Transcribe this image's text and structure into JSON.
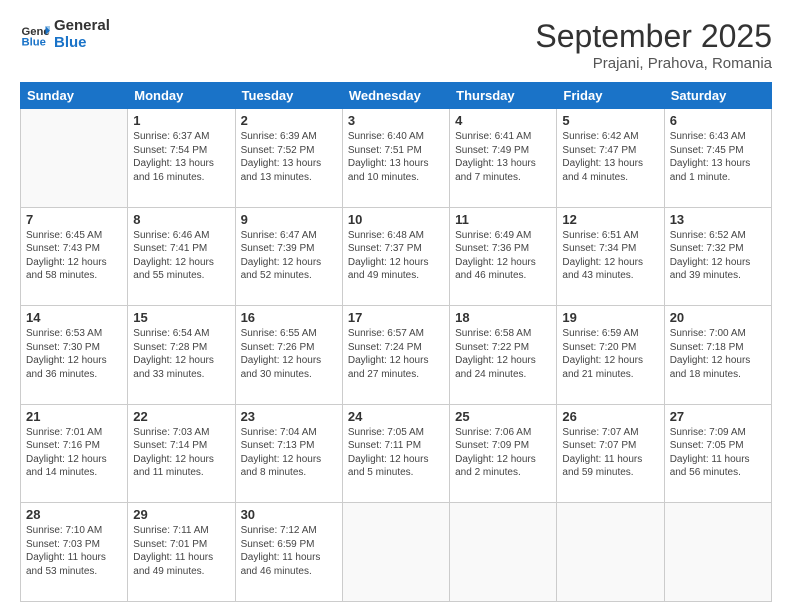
{
  "logo": {
    "line1": "General",
    "line2": "Blue"
  },
  "title": "September 2025",
  "location": "Prajani, Prahova, Romania",
  "days_header": [
    "Sunday",
    "Monday",
    "Tuesday",
    "Wednesday",
    "Thursday",
    "Friday",
    "Saturday"
  ],
  "weeks": [
    [
      {
        "day": "",
        "info": ""
      },
      {
        "day": "1",
        "info": "Sunrise: 6:37 AM\nSunset: 7:54 PM\nDaylight: 13 hours and 16 minutes."
      },
      {
        "day": "2",
        "info": "Sunrise: 6:39 AM\nSunset: 7:52 PM\nDaylight: 13 hours and 13 minutes."
      },
      {
        "day": "3",
        "info": "Sunrise: 6:40 AM\nSunset: 7:51 PM\nDaylight: 13 hours and 10 minutes."
      },
      {
        "day": "4",
        "info": "Sunrise: 6:41 AM\nSunset: 7:49 PM\nDaylight: 13 hours and 7 minutes."
      },
      {
        "day": "5",
        "info": "Sunrise: 6:42 AM\nSunset: 7:47 PM\nDaylight: 13 hours and 4 minutes."
      },
      {
        "day": "6",
        "info": "Sunrise: 6:43 AM\nSunset: 7:45 PM\nDaylight: 13 hours and 1 minute."
      }
    ],
    [
      {
        "day": "7",
        "info": "Sunrise: 6:45 AM\nSunset: 7:43 PM\nDaylight: 12 hours and 58 minutes."
      },
      {
        "day": "8",
        "info": "Sunrise: 6:46 AM\nSunset: 7:41 PM\nDaylight: 12 hours and 55 minutes."
      },
      {
        "day": "9",
        "info": "Sunrise: 6:47 AM\nSunset: 7:39 PM\nDaylight: 12 hours and 52 minutes."
      },
      {
        "day": "10",
        "info": "Sunrise: 6:48 AM\nSunset: 7:37 PM\nDaylight: 12 hours and 49 minutes."
      },
      {
        "day": "11",
        "info": "Sunrise: 6:49 AM\nSunset: 7:36 PM\nDaylight: 12 hours and 46 minutes."
      },
      {
        "day": "12",
        "info": "Sunrise: 6:51 AM\nSunset: 7:34 PM\nDaylight: 12 hours and 43 minutes."
      },
      {
        "day": "13",
        "info": "Sunrise: 6:52 AM\nSunset: 7:32 PM\nDaylight: 12 hours and 39 minutes."
      }
    ],
    [
      {
        "day": "14",
        "info": "Sunrise: 6:53 AM\nSunset: 7:30 PM\nDaylight: 12 hours and 36 minutes."
      },
      {
        "day": "15",
        "info": "Sunrise: 6:54 AM\nSunset: 7:28 PM\nDaylight: 12 hours and 33 minutes."
      },
      {
        "day": "16",
        "info": "Sunrise: 6:55 AM\nSunset: 7:26 PM\nDaylight: 12 hours and 30 minutes."
      },
      {
        "day": "17",
        "info": "Sunrise: 6:57 AM\nSunset: 7:24 PM\nDaylight: 12 hours and 27 minutes."
      },
      {
        "day": "18",
        "info": "Sunrise: 6:58 AM\nSunset: 7:22 PM\nDaylight: 12 hours and 24 minutes."
      },
      {
        "day": "19",
        "info": "Sunrise: 6:59 AM\nSunset: 7:20 PM\nDaylight: 12 hours and 21 minutes."
      },
      {
        "day": "20",
        "info": "Sunrise: 7:00 AM\nSunset: 7:18 PM\nDaylight: 12 hours and 18 minutes."
      }
    ],
    [
      {
        "day": "21",
        "info": "Sunrise: 7:01 AM\nSunset: 7:16 PM\nDaylight: 12 hours and 14 minutes."
      },
      {
        "day": "22",
        "info": "Sunrise: 7:03 AM\nSunset: 7:14 PM\nDaylight: 12 hours and 11 minutes."
      },
      {
        "day": "23",
        "info": "Sunrise: 7:04 AM\nSunset: 7:13 PM\nDaylight: 12 hours and 8 minutes."
      },
      {
        "day": "24",
        "info": "Sunrise: 7:05 AM\nSunset: 7:11 PM\nDaylight: 12 hours and 5 minutes."
      },
      {
        "day": "25",
        "info": "Sunrise: 7:06 AM\nSunset: 7:09 PM\nDaylight: 12 hours and 2 minutes."
      },
      {
        "day": "26",
        "info": "Sunrise: 7:07 AM\nSunset: 7:07 PM\nDaylight: 11 hours and 59 minutes."
      },
      {
        "day": "27",
        "info": "Sunrise: 7:09 AM\nSunset: 7:05 PM\nDaylight: 11 hours and 56 minutes."
      }
    ],
    [
      {
        "day": "28",
        "info": "Sunrise: 7:10 AM\nSunset: 7:03 PM\nDaylight: 11 hours and 53 minutes."
      },
      {
        "day": "29",
        "info": "Sunrise: 7:11 AM\nSunset: 7:01 PM\nDaylight: 11 hours and 49 minutes."
      },
      {
        "day": "30",
        "info": "Sunrise: 7:12 AM\nSunset: 6:59 PM\nDaylight: 11 hours and 46 minutes."
      },
      {
        "day": "",
        "info": ""
      },
      {
        "day": "",
        "info": ""
      },
      {
        "day": "",
        "info": ""
      },
      {
        "day": "",
        "info": ""
      }
    ]
  ]
}
